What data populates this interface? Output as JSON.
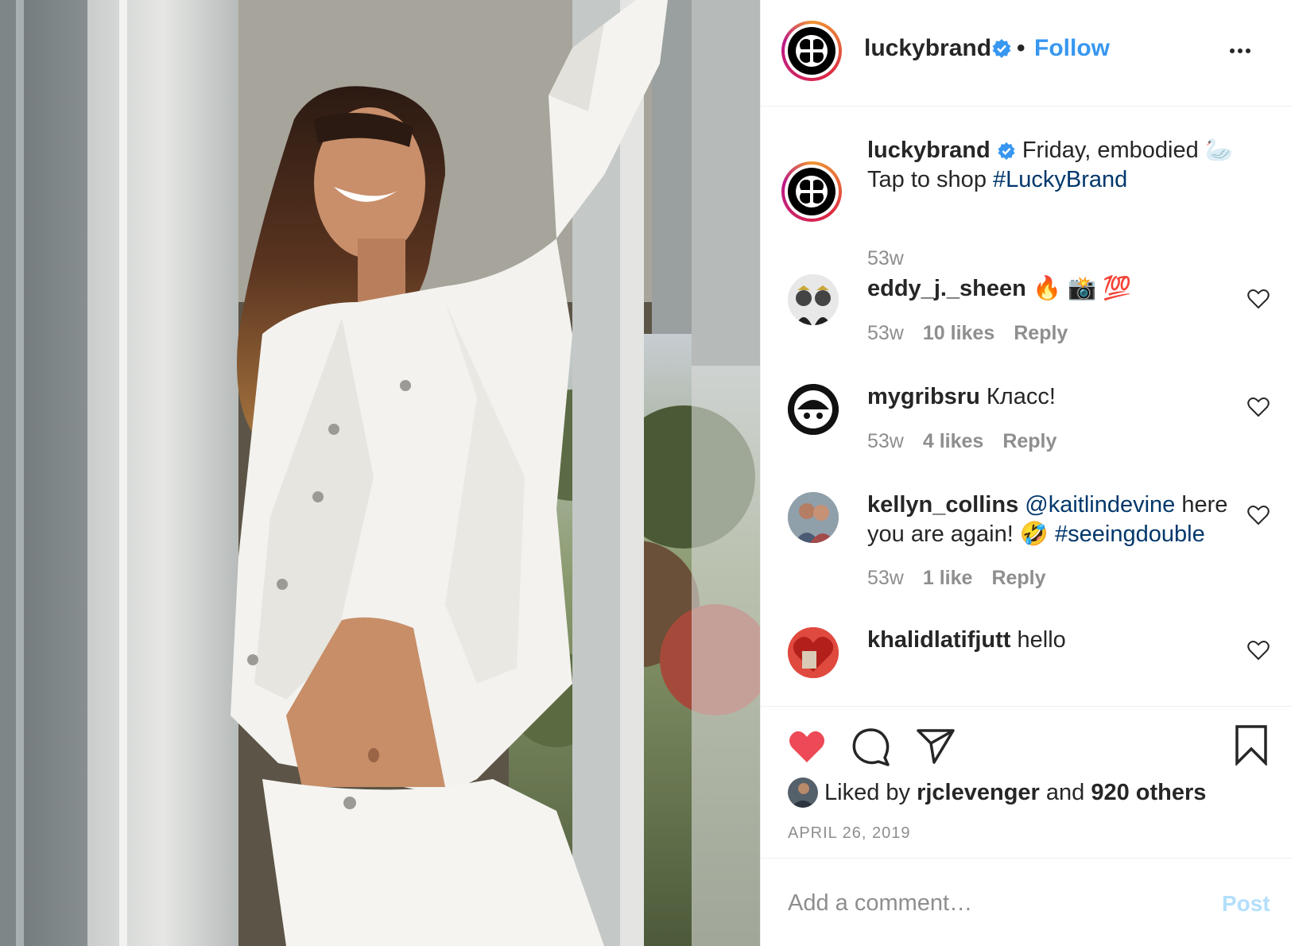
{
  "post": {
    "username": "luckybrand",
    "follow_label": "Follow",
    "separator": "•",
    "caption": {
      "username": "luckybrand",
      "text": "Friday, embodied 🦢 Tap to shop",
      "hashtag": "#LuckyBrand",
      "age": "53w"
    },
    "likes_text_prefix": "Liked by",
    "liked_by_user": "rjclevenger",
    "likes_text_and": "and",
    "likes_others": "920 others",
    "date": "APRIL 26, 2019",
    "comment_placeholder": "Add a comment…",
    "post_button_label": "Post"
  },
  "comments": [
    {
      "username": "eddy_j._sheen",
      "text": "🔥 📸 💯",
      "age": "53w",
      "likes": "10 likes",
      "reply": "Reply"
    },
    {
      "username": "mygribsru",
      "text": "Класс!",
      "age": "53w",
      "likes": "4 likes",
      "reply": "Reply"
    },
    {
      "username": "kellyn_collins",
      "mention": "@kaitlindevine",
      "text_a": "here",
      "text_b": "you are again! 🤣",
      "hashtag": "#seeingdouble",
      "age": "53w",
      "likes": "1 like",
      "reply": "Reply"
    },
    {
      "username": "khalidlatifjutt",
      "text": "hello"
    }
  ],
  "icons": {
    "like": "heart-filled-icon",
    "comment": "comment-bubble-icon",
    "share": "paper-plane-icon",
    "save": "bookmark-icon",
    "more": "more-options-icon",
    "verified": "verified-badge-icon"
  },
  "colors": {
    "link_blue": "#3897f0",
    "heart_red": "#ed4956",
    "post_disabled": "#b2dffc",
    "mention_navy": "#00376b"
  }
}
